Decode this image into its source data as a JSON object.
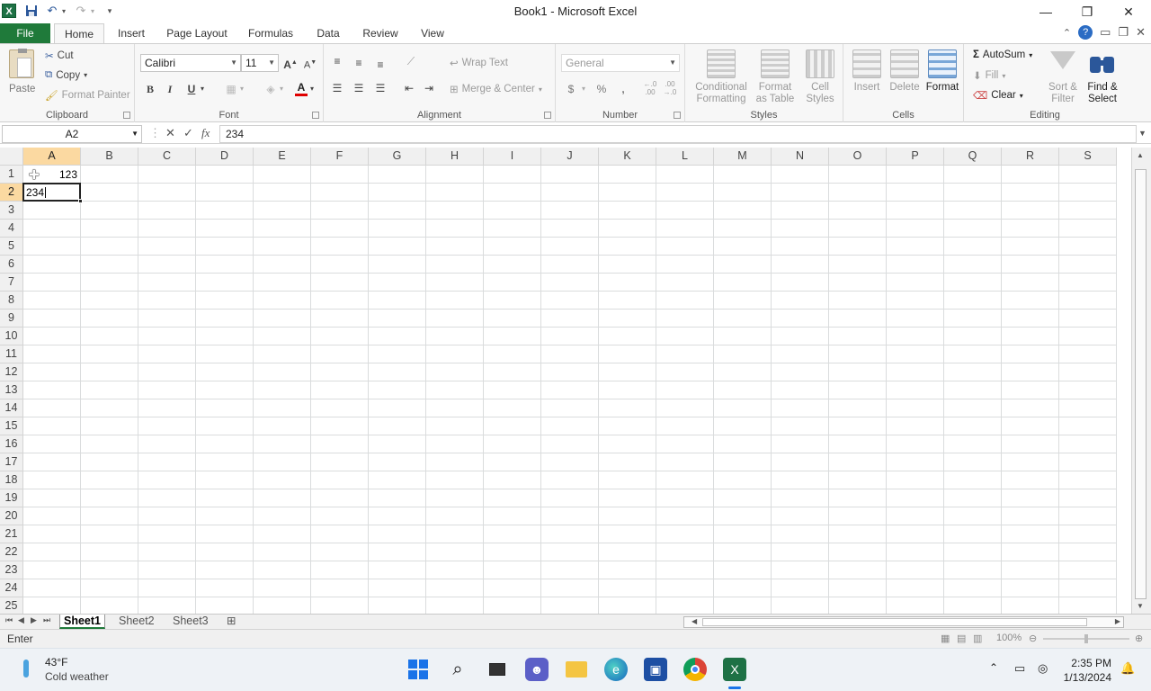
{
  "window": {
    "title": "Book1  -  Microsoft Excel",
    "app_icon": "X"
  },
  "ribbon_tabs": [
    "File",
    "Home",
    "Insert",
    "Page Layout",
    "Formulas",
    "Data",
    "Review",
    "View"
  ],
  "active_tab": "Home",
  "clipboard": {
    "paste": "Paste",
    "cut": "Cut",
    "copy": "Copy",
    "format_painter": "Format Painter",
    "label": "Clipboard"
  },
  "font": {
    "name": "Calibri",
    "size": "11",
    "bold": "B",
    "italic": "I",
    "underline": "U",
    "label": "Font"
  },
  "alignment": {
    "wrap_text": "Wrap Text",
    "merge_center": "Merge & Center",
    "label": "Alignment"
  },
  "number": {
    "format": "General",
    "currency": "$",
    "percent": "%",
    "comma": ",",
    "inc_decimal": "←.0\n.00",
    "dec_decimal": ".00\n→.0",
    "label": "Number"
  },
  "styles": {
    "conditional": "Conditional",
    "conditional2": "Formatting",
    "format_table": "Format",
    "format_table2": "as Table",
    "cell_styles": "Cell",
    "cell_styles2": "Styles",
    "label": "Styles"
  },
  "cells": {
    "insert": "Insert",
    "delete": "Delete",
    "format": "Format",
    "label": "Cells"
  },
  "editing": {
    "autosum": "AutoSum",
    "fill": "Fill",
    "clear": "Clear",
    "sort": "Sort &",
    "sort2": "Filter",
    "find": "Find &",
    "find2": "Select",
    "label": "Editing"
  },
  "formula_bar": {
    "name_box": "A2",
    "fx": "fx",
    "value": "234"
  },
  "columns": [
    "A",
    "B",
    "C",
    "D",
    "E",
    "F",
    "G",
    "H",
    "I",
    "J",
    "K",
    "L",
    "M",
    "N",
    "O",
    "P",
    "Q",
    "R",
    "S"
  ],
  "rows": [
    "1",
    "2",
    "3",
    "4",
    "5",
    "6",
    "7",
    "8",
    "9",
    "10",
    "11",
    "12",
    "13",
    "14",
    "15",
    "16",
    "17",
    "18",
    "19",
    "20",
    "21",
    "22",
    "23",
    "24",
    "25"
  ],
  "cell_values": {
    "A1": "123",
    "A2": "234"
  },
  "active_cell": "A2",
  "sheets": [
    "Sheet1",
    "Sheet2",
    "Sheet3"
  ],
  "active_sheet": "Sheet1",
  "status": {
    "mode": "Enter",
    "zoom": "100%"
  },
  "taskbar": {
    "temperature": "43°F",
    "weather": "Cold weather",
    "time": "2:35 PM",
    "date": "1/13/2024"
  }
}
